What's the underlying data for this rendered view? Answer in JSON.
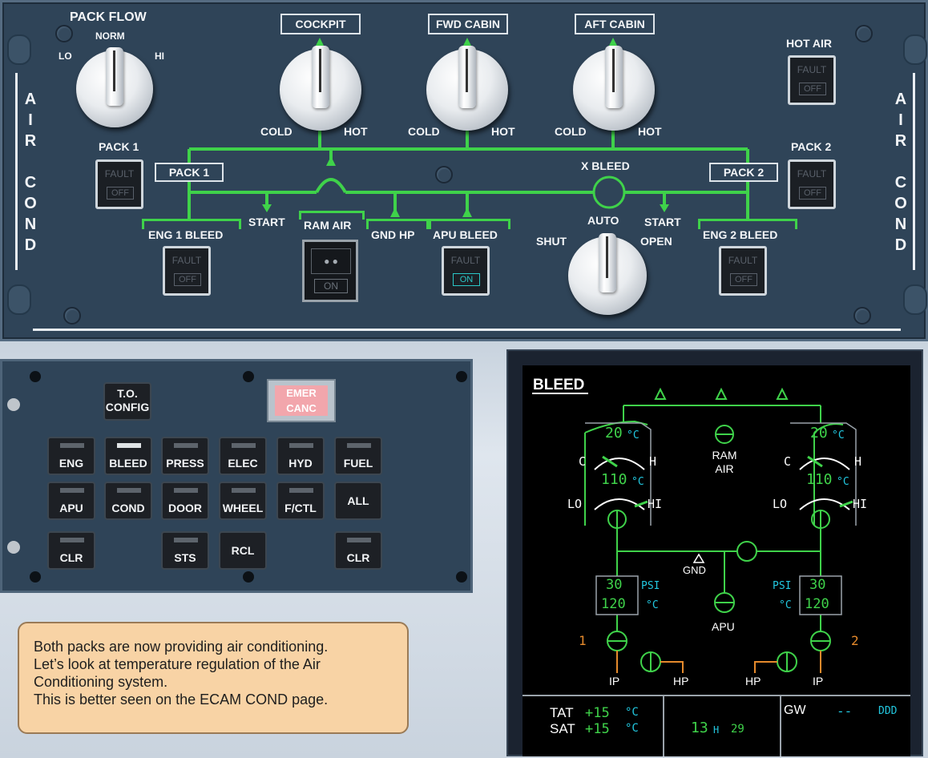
{
  "overhead": {
    "side_label": "A\nI\nR\n\nC\nO\nN\nD",
    "pack_flow": {
      "title": "PACK FLOW",
      "norm": "NORM",
      "lo": "LO",
      "hi": "HI"
    },
    "zones": [
      {
        "name": "COCKPIT",
        "cold": "COLD",
        "hot": "HOT"
      },
      {
        "name": "FWD CABIN",
        "cold": "COLD",
        "hot": "HOT"
      },
      {
        "name": "AFT CABIN",
        "cold": "COLD",
        "hot": "HOT"
      }
    ],
    "hot_air": {
      "label": "HOT AIR",
      "fault": "FAULT",
      "off": "OFF"
    },
    "pack1": {
      "label": "PACK 1",
      "fault": "FAULT",
      "off": "OFF",
      "box": "PACK 1"
    },
    "pack2": {
      "label": "PACK 2",
      "fault": "FAULT",
      "off": "OFF",
      "box": "PACK 2"
    },
    "eng1_bleed": {
      "label": "ENG 1 BLEED",
      "fault": "FAULT",
      "off": "OFF"
    },
    "eng2_bleed": {
      "label": "ENG 2 BLEED",
      "fault": "FAULT",
      "off": "OFF"
    },
    "start_left": "START",
    "start_right": "START",
    "ram_air": {
      "label": "RAM AIR",
      "state": "ON"
    },
    "gnd_hp": "GND HP",
    "apu_bleed": {
      "label": "APU BLEED",
      "fault": "FAULT",
      "on": "ON"
    },
    "x_bleed": {
      "label": "X BLEED",
      "shut": "SHUT",
      "auto": "AUTO",
      "open": "OPEN"
    }
  },
  "ecam_control": {
    "to_config": "T.O.\nCONFIG",
    "emer_canc": "EMER\nCANC",
    "row1": [
      "ENG",
      "BLEED",
      "PRESS",
      "ELEC",
      "HYD",
      "FUEL"
    ],
    "row2": [
      "APU",
      "COND",
      "DOOR",
      "WHEEL",
      "F/CTL",
      "ALL"
    ],
    "clr_left": "CLR",
    "sts": "STS",
    "rcl": "RCL",
    "clr_right": "CLR"
  },
  "message": {
    "line1": "Both packs are now providing air conditioning.",
    "line2": "Let’s look at temperature regulation of the Air",
    "line3": "Conditioning system.",
    "line4": "This is better seen on the ECAM COND page."
  },
  "ecam_display": {
    "title": "BLEED",
    "left_pack": {
      "outlet_temp": "20",
      "unit": "°C",
      "c": "C",
      "h": "H",
      "comp_temp": "110",
      "lo": "LO",
      "hi": "HI"
    },
    "right_pack": {
      "outlet_temp": "20",
      "unit": "°C",
      "c": "C",
      "h": "H",
      "comp_temp": "110",
      "lo": "LO",
      "hi": "HI"
    },
    "ram_air": "RAM\nAIR",
    "gnd": "GND",
    "apu": "APU",
    "left_eng": {
      "psi": "30",
      "temp": "120",
      "psi_unit": "PSI",
      "deg_unit": "°C",
      "num": "1",
      "ip": "IP",
      "hp": "HP"
    },
    "right_eng": {
      "psi": "30",
      "temp": "120",
      "psi_unit": "PSI",
      "deg_unit": "°C",
      "num": "2",
      "ip": "IP",
      "hp": "HP"
    },
    "tat_label": "TAT",
    "tat_value": "+15",
    "tat_unit": "°C",
    "sat_label": "SAT",
    "sat_value": "+15",
    "sat_unit": "°C",
    "clock_h": "13",
    "clock_sep": "H",
    "clock_m": "29",
    "gw_label": "GW",
    "gw_value": "--",
    "gw_unit": "DDD"
  },
  "colors": {
    "green": "#3fd24a",
    "cyan": "#22c8e0",
    "amber": "#e58a2c",
    "white": "#ffffff"
  }
}
